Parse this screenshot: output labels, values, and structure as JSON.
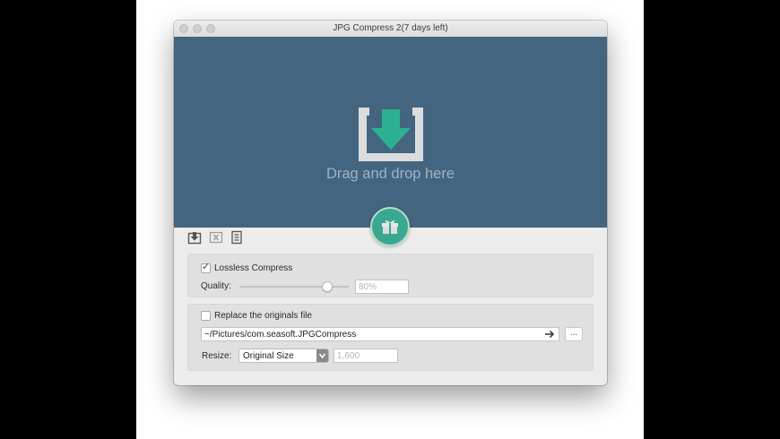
{
  "window": {
    "title": "JPG Compress 2(7 days left)"
  },
  "drop_area": {
    "text": "Drag and drop here",
    "background": "#44657f",
    "accent": "#2bb191"
  },
  "toolbar": {
    "icons": [
      "import-icon",
      "clear-icon",
      "list-icon"
    ]
  },
  "compress": {
    "lossless_label": "Lossless Compress",
    "lossless_checked": true,
    "quality_label": "Quality:",
    "quality_value": "80%",
    "quality_fraction": 0.8
  },
  "output": {
    "replace_label": "Replace the originals file",
    "replace_checked": false,
    "path": "~/Pictures/com.seasoft.JPGCompress",
    "browse_label": "...",
    "resize_label": "Resize:",
    "resize_selected": "Original Size",
    "resize_width": "1,600"
  }
}
